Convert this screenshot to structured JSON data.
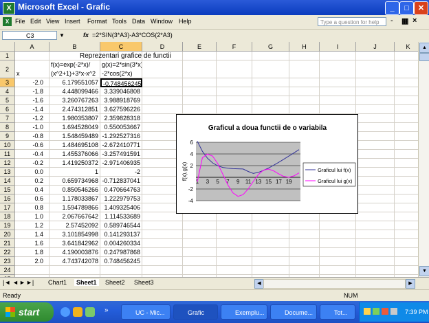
{
  "window": {
    "title": "Microsoft Excel - Grafic",
    "icon": "excel-icon"
  },
  "menu": {
    "items": [
      "File",
      "Edit",
      "View",
      "Insert",
      "Format",
      "Tools",
      "Data",
      "Window",
      "Help"
    ],
    "help_placeholder": "Type a question for help",
    "doc_controls": [
      "-",
      "×"
    ]
  },
  "formula_bar": {
    "name_box": "C3",
    "fx_label": "fx",
    "formula": "=2*SIN(3*A3)-A3*COS(2*A3)"
  },
  "columns": [
    "A",
    "B",
    "C",
    "D",
    "E",
    "F",
    "G",
    "H",
    "I",
    "J",
    "K"
  ],
  "rows": [
    "1",
    "2",
    "3",
    "4",
    "5",
    "6",
    "7",
    "8",
    "9",
    "10",
    "11",
    "12",
    "13",
    "14",
    "15",
    "16",
    "17",
    "18",
    "19",
    "20",
    "21",
    "22",
    "23",
    "24",
    "25"
  ],
  "sheet": {
    "title": "Reprezentari grafice de functii",
    "header": {
      "a": "x",
      "b1": "f(x)=exp(-2*x)/",
      "b2": "(x^2+1)+3*x-x^2",
      "c1": "g(x)=2*sin(3*x)",
      "c2": "-2*cos(2*x)"
    },
    "data": [
      [
        "-2.0",
        "6.179551057",
        "-0.748456245"
      ],
      [
        "-1.8",
        "4.448099466",
        "3.339046808"
      ],
      [
        "-1.6",
        "3.260767263",
        "3.988918769"
      ],
      [
        "-1.4",
        "2.474312851",
        "3.627596226"
      ],
      [
        "-1.2",
        "1.980353807",
        "2.359828318"
      ],
      [
        "-1.0",
        "1.694528049",
        "0.550053667"
      ],
      [
        "-0.8",
        "1.548459489",
        "-1.292527316"
      ],
      [
        "-0.6",
        "1.484695108",
        "-2.672410771"
      ],
      [
        "-0.4",
        "1.455376066",
        "-3.257491591"
      ],
      [
        "-0.2",
        "1.419250372",
        "-2.971406935"
      ],
      [
        "0.0",
        "1",
        "-2"
      ],
      [
        "0.2",
        "0.659734968",
        "-0.712837041"
      ],
      [
        "0.4",
        "0.850546266",
        "0.470664763"
      ],
      [
        "0.6",
        "1.178033867",
        "1.222979753"
      ],
      [
        "0.8",
        "1.594789866",
        "1.409325406"
      ],
      [
        "1.0",
        "2.067667642",
        "1.114533689"
      ],
      [
        "1.2",
        "2.57452092",
        "0.589746544"
      ],
      [
        "1.4",
        "3.101854998",
        "0.141293137"
      ],
      [
        "1.6",
        "3.641842962",
        "0.004260334"
      ],
      [
        "1.8",
        "4.190003876",
        "0.247987868"
      ],
      [
        "2.0",
        "4.743742078",
        "0.748456245"
      ]
    ]
  },
  "chart_data": {
    "type": "line",
    "title": "Graficul a doua functii de o variabila",
    "ylabel": "f(x),g(x)",
    "xlabel": "",
    "x_ticks": [
      "1",
      "3",
      "5",
      "7",
      "9",
      "11",
      "13",
      "15",
      "17",
      "19"
    ],
    "y_ticks": [
      6,
      4,
      2,
      -2,
      -4
    ],
    "ylim": [
      -4,
      6
    ],
    "series": [
      {
        "name": "Graficul lui f(x)",
        "color": "#333399",
        "values": [
          6.18,
          4.45,
          3.26,
          2.47,
          1.98,
          1.69,
          1.55,
          1.48,
          1.46,
          1.42,
          1,
          0.66,
          0.85,
          1.18,
          1.59,
          2.07,
          2.57,
          3.1,
          3.64,
          4.19,
          4.74
        ]
      },
      {
        "name": "Graficul lui g(x)",
        "color": "#ff00ff",
        "values": [
          -0.75,
          3.34,
          3.99,
          3.63,
          2.36,
          0.55,
          -1.29,
          -2.67,
          -3.26,
          -2.97,
          -2,
          -0.71,
          0.47,
          1.22,
          1.41,
          1.11,
          0.59,
          0.14,
          0.0,
          0.25,
          0.75
        ]
      }
    ]
  },
  "tabs": {
    "nav": [
      "|◄",
      "◄",
      "►",
      "►|"
    ],
    "sheets": [
      "Chart1",
      "Sheet1",
      "Sheet2",
      "Sheet3"
    ],
    "active": "Sheet1"
  },
  "status": {
    "left": "Ready",
    "right": "NUM"
  },
  "taskbar": {
    "start": "start",
    "buttons": [
      "UC - Mic...",
      "Grafic",
      "Exemplu...",
      "Docume...",
      "Tot..."
    ],
    "clock": "7:39 PM"
  }
}
